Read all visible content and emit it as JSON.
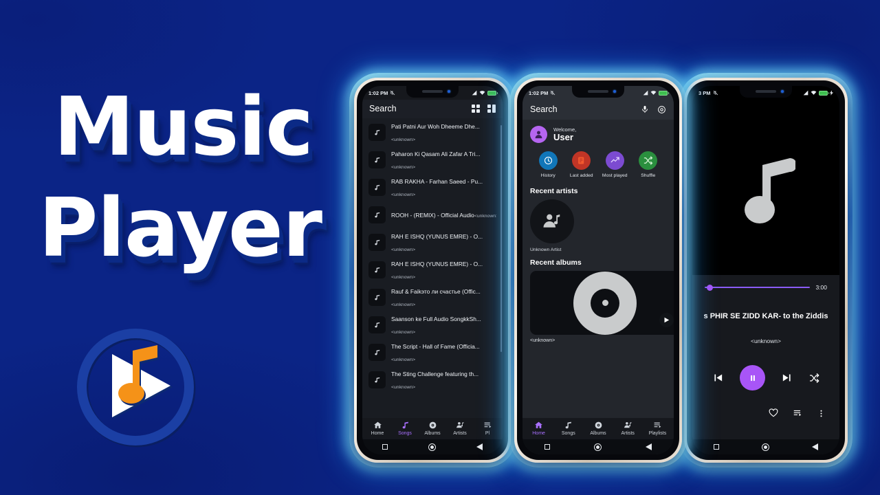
{
  "brand": {
    "title_line1": "Music",
    "title_line2": "Player",
    "logo_name": "music-player-logo"
  },
  "phone_left": {
    "status": {
      "time": "1:02 PM",
      "mute_icon": "mute-icon",
      "signal_icon": "signal-icon",
      "wifi_icon": "wifi-icon",
      "battery_icon": "battery-icon"
    },
    "header": {
      "title": "Search",
      "grid_icon": "grid-view-icon",
      "list_icon": "list-view-icon"
    },
    "songs": [
      {
        "title": "Pati Patni Aur Woh Dheeme Dhe...",
        "artist": "<unknown>"
      },
      {
        "title": "Paharon Ki Qasam Ali Zafar A Tri...",
        "artist": "<unknown>"
      },
      {
        "title": "RAB RAKHA - Farhan Saeed - Pu...",
        "artist": "<unknown>"
      },
      {
        "title": "ROOH - (REMIX) - Official Audio",
        "artist": "<unknown>"
      },
      {
        "title": "RAH E ISHQ (YUNUS EMRE) - O...",
        "artist": "<unknown>"
      },
      {
        "title": "RAH E ISHQ (YUNUS EMRE) - O...",
        "artist": "<unknown>"
      },
      {
        "title": "Rauf & Faikэто ли счастье (Offic...",
        "artist": "<unknown>"
      },
      {
        "title": "Saanson ke Full Audio SongkkSh...",
        "artist": "<unknown>"
      },
      {
        "title": "The Script - Hall of Fame (Officia...",
        "artist": "<unknown>"
      },
      {
        "title": "The Sting Challenge featuring th...",
        "artist": "<unknown>"
      }
    ],
    "tabs": [
      {
        "label": "Home",
        "icon": "home-icon",
        "active": false
      },
      {
        "label": "Songs",
        "icon": "music-note-icon",
        "active": true
      },
      {
        "label": "Albums",
        "icon": "disc-icon",
        "active": false
      },
      {
        "label": "Artists",
        "icon": "artist-icon",
        "active": false
      },
      {
        "label": "Pl",
        "icon": "playlist-icon",
        "active": false
      }
    ],
    "navbar": {
      "recents_icon": "square-icon",
      "home_icon": "circle-icon",
      "back_icon": "triangle-back-icon"
    }
  },
  "phone_center": {
    "status": {
      "time": "1:02 PM",
      "mute_icon": "mute-icon",
      "signal_icon": "signal-icon",
      "wifi_icon": "wifi-icon",
      "battery_icon": "battery-icon"
    },
    "header": {
      "title": "Search",
      "mic_icon": "microphone-icon",
      "settings_icon": "gear-icon"
    },
    "welcome": {
      "greeting": "Welcome,",
      "username": "User",
      "avatar_icon": "user-avatar-icon",
      "avatar_color": "#b565f0"
    },
    "quick_actions": [
      {
        "label": "History",
        "icon": "clock-icon",
        "color": "#1176b8"
      },
      {
        "label": "Last added",
        "icon": "library-add-icon",
        "color": "#c03526"
      },
      {
        "label": "Most played",
        "icon": "trending-up-icon",
        "color": "#7c4bd1"
      },
      {
        "label": "Shuffle",
        "icon": "shuffle-icon",
        "color": "#2a8f3e"
      }
    ],
    "recent_artists": {
      "heading": "Recent artists",
      "items": [
        {
          "name": "Unknown Artist",
          "icon": "artist-icon"
        }
      ]
    },
    "recent_albums": {
      "heading": "Recent albums",
      "items": [
        {
          "name": "<unknown>",
          "icon": "vinyl-disc-icon",
          "play_icon": "play-icon"
        }
      ]
    },
    "tabs": [
      {
        "label": "Home",
        "icon": "home-icon",
        "active": true
      },
      {
        "label": "Songs",
        "icon": "music-note-icon",
        "active": false
      },
      {
        "label": "Albums",
        "icon": "disc-icon",
        "active": false
      },
      {
        "label": "Artists",
        "icon": "artist-icon",
        "active": false
      },
      {
        "label": "Playlists",
        "icon": "playlist-icon",
        "active": false
      }
    ],
    "navbar": {
      "recents_icon": "square-icon",
      "home_icon": "circle-icon",
      "back_icon": "triangle-back-icon"
    }
  },
  "phone_right": {
    "status": {
      "time": "3 PM",
      "mute_icon": "mute-icon",
      "signal_icon": "signal-icon",
      "wifi_icon": "wifi-icon",
      "battery_icon": "battery-charging-icon"
    },
    "artwork_icon": "music-note-icon",
    "seek": {
      "duration": "3:00",
      "progress_percent": 2,
      "accent": "#a855f7"
    },
    "now_playing": {
      "title": "s PHIR SE ZIDD KAR- to the Ziddis",
      "artist": "<unknown>"
    },
    "controls": [
      {
        "name": "previous",
        "icon": "skip-previous-icon"
      },
      {
        "name": "play-pause",
        "icon": "pause-icon"
      },
      {
        "name": "next",
        "icon": "skip-next-icon"
      },
      {
        "name": "shuffle",
        "icon": "shuffle-icon"
      }
    ],
    "bottom_actions": [
      {
        "name": "favorite",
        "icon": "heart-icon"
      },
      {
        "name": "queue",
        "icon": "queue-icon"
      },
      {
        "name": "more",
        "icon": "more-vertical-icon"
      }
    ],
    "navbar": {
      "recents_icon": "square-icon",
      "home_icon": "circle-icon",
      "back_icon": "triangle-back-icon"
    }
  },
  "theme": {
    "bg_deep": "#0b2486",
    "bg_bright": "#19bdf5",
    "accent_purple": "#a855f7",
    "logo_blue": "#1a3fa0",
    "logo_orange": "#f59218"
  }
}
